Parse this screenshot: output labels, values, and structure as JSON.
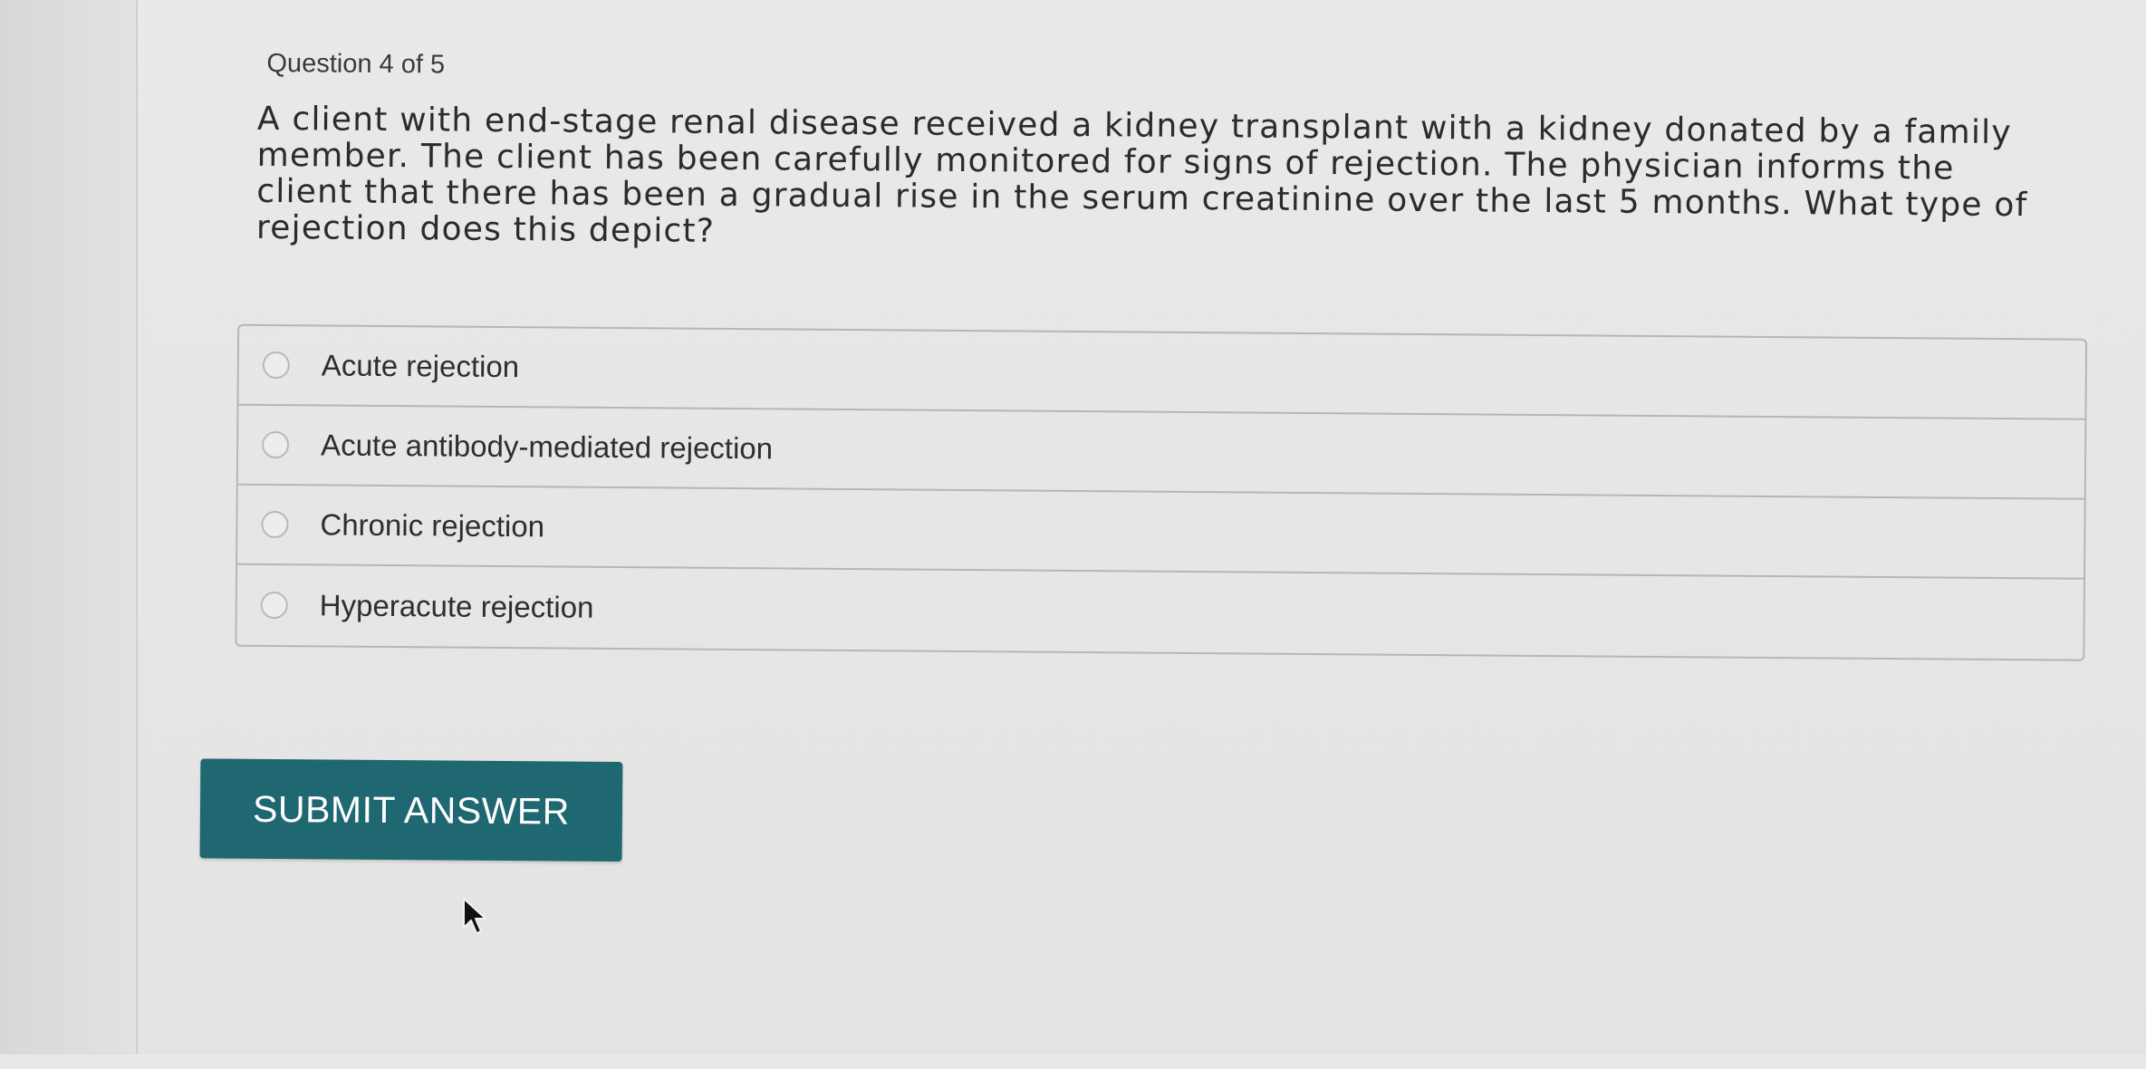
{
  "quiz": {
    "counter": "Question 4 of 5",
    "question": "A client with end-stage renal disease received a kidney transplant with a kidney donated by a family member. The client has been carefully monitored for signs of rejection. The physician informs the client that there has been a gradual rise in the serum creatinine over the last 5 months. What type of rejection does this depict?",
    "options": [
      {
        "label": "Acute rejection",
        "selected": false
      },
      {
        "label": "Acute antibody-mediated rejection",
        "selected": false
      },
      {
        "label": "Chronic rejection",
        "selected": false
      },
      {
        "label": "Hyperacute rejection",
        "selected": false
      }
    ],
    "submit_label": "SUBMIT ANSWER"
  },
  "colors": {
    "submit_bg": "#1f6771",
    "submit_text": "#ffffff",
    "page_bg": "#e6e6e5",
    "border": "#b6b6b5"
  },
  "icons": {
    "cursor": "mouse-pointer-icon",
    "radio": "radio-button-icon"
  }
}
